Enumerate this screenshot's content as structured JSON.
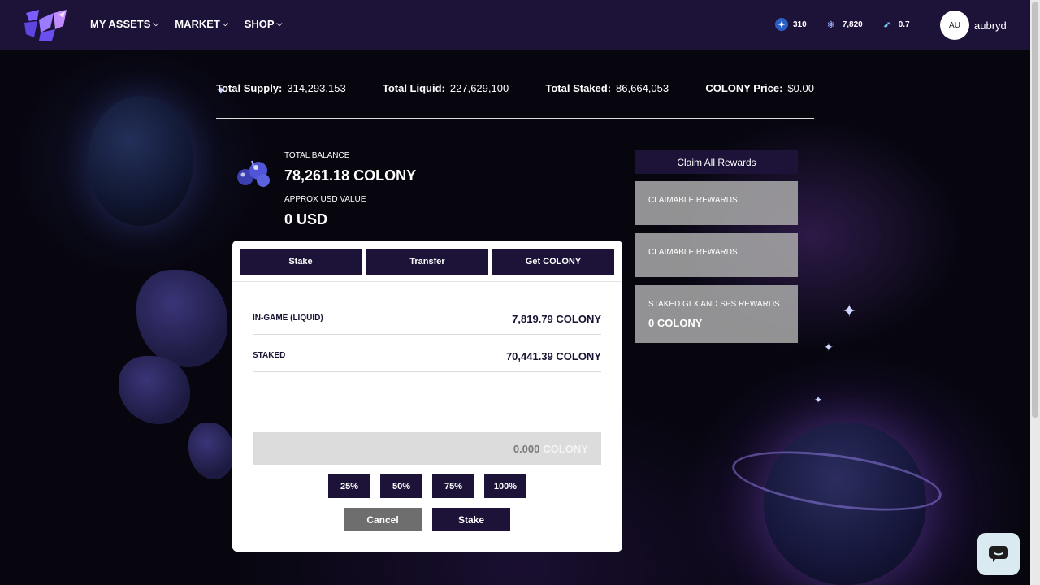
{
  "nav": {
    "menu": [
      {
        "label": "MY ASSETS"
      },
      {
        "label": "MARKET"
      },
      {
        "label": "SHOP"
      }
    ],
    "stats": [
      {
        "icon": "star-token-icon",
        "value": "310"
      },
      {
        "icon": "colony-token-icon",
        "value": "7,820"
      },
      {
        "icon": "rocket-token-icon",
        "value": "0.7"
      }
    ],
    "avatar_initials": "AU",
    "username": "aubryd"
  },
  "supply": {
    "total_supply_label": "Total Supply:",
    "total_supply": "314,293,153",
    "total_liquid_label": "Total Liquid:",
    "total_liquid": "227,629,100",
    "total_staked_label": "Total Staked:",
    "total_staked": "86,664,053",
    "price_label": "COLONY Price:",
    "price": "$0.00"
  },
  "balance": {
    "total_label": "TOTAL BALANCE",
    "total_value": "78,261.18 COLONY",
    "usd_label": "APPROX USD VALUE",
    "usd_value": "0 USD"
  },
  "card": {
    "tabs": [
      "Stake",
      "Transfer",
      "Get COLONY"
    ],
    "rows": [
      {
        "label": "IN-GAME (LIQUID)",
        "value": "7,819.79 COLONY"
      },
      {
        "label": "STAKED",
        "value": "70,441.39 COLONY"
      }
    ],
    "amount_value": "0.000",
    "amount_unit": "COLONY",
    "percents": [
      "25%",
      "50%",
      "75%",
      "100%"
    ],
    "cancel_label": "Cancel",
    "stake_label": "Stake"
  },
  "rewards": {
    "claim_all_label": "Claim All Rewards",
    "items": [
      {
        "label": "CLAIMABLE REWARDS",
        "value": ""
      },
      {
        "label": "CLAIMABLE REWARDS",
        "value": ""
      },
      {
        "label": "STAKED GLX AND SPS REWARDS",
        "value": "0 COLONY"
      }
    ]
  },
  "colors": {
    "nav_bg": "#1d1238",
    "button_bg": "#1d1238",
    "cancel_bg": "#6e6e6e"
  }
}
